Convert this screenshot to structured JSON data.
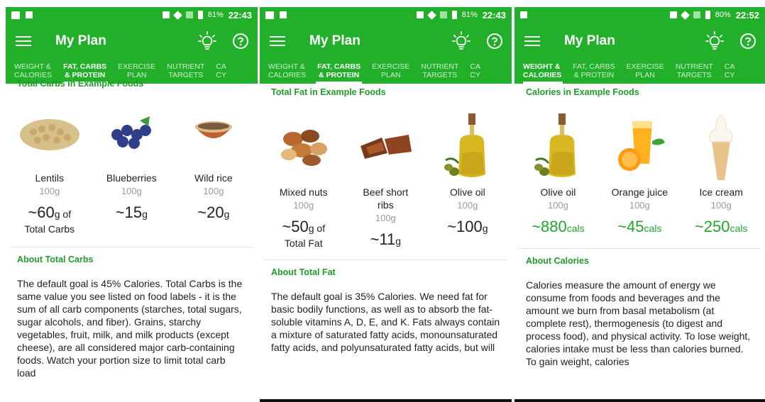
{
  "status": {
    "battery": [
      "81%",
      "81%",
      "80%"
    ],
    "time": [
      "22:43",
      "22:43",
      "22:52"
    ]
  },
  "appbar": {
    "title": "My Plan"
  },
  "tabs": {
    "weight": [
      "WEIGHT &",
      "CALORIES"
    ],
    "fat": [
      "FAT, CARBS",
      "& PROTEIN"
    ],
    "exercise": [
      "EXERCISE",
      "PLAN"
    ],
    "nutrient": [
      "NUTRIENT",
      "TARGETS"
    ],
    "cycle_partial": [
      "CA",
      "CY"
    ]
  },
  "screens": [
    {
      "active_tab": "fat",
      "section": "Total Carbs in Example Foods",
      "foods": [
        {
          "name": "Lentils",
          "portion": "100g",
          "amount": "~60",
          "unit": "g",
          "suffix": " of",
          "note": "Total Carbs"
        },
        {
          "name": "Blueberries",
          "portion": "100g",
          "amount": "~15",
          "unit": "g"
        },
        {
          "name": "Wild rice",
          "portion": "100g",
          "amount": "~20",
          "unit": "g"
        }
      ],
      "about_title": "About Total Carbs",
      "about_text": "The default goal is 45% Calories. Total Carbs is the same value you see listed on food labels - it is the sum of all carb components (starches, total sugars, sugar alcohols, and fiber). Grains, starchy vegetables, fruit, milk, and milk products (except cheese), are all considered major carb-containing foods. Watch your portion size to limit total carb load"
    },
    {
      "active_tab": "fat",
      "section": "Total Fat in Example Foods",
      "foods": [
        {
          "name": "Mixed nuts",
          "portion": "100g",
          "amount": "~50",
          "unit": "g",
          "suffix": " of",
          "note": "Total Fat"
        },
        {
          "name": "Beef short ribs",
          "portion": "100g",
          "amount": "~11",
          "unit": "g"
        },
        {
          "name": "Olive oil",
          "portion": "100g",
          "amount": "~100",
          "unit": "g"
        }
      ],
      "about_title": "About Total Fat",
      "about_text": "The default goal is 35% Calories. We need fat for basic bodily functions, as well as to absorb the fat-soluble vitamins A, D, E, and K. Fats always contain a mixture of saturated fatty acids, monounsaturated fatty acids, and polyunsaturated fatty acids, but will"
    },
    {
      "active_tab": "weight",
      "section": "Calories in Example Foods",
      "foods": [
        {
          "name": "Olive oil",
          "portion": "100g",
          "amount": "~880",
          "unit": "cals"
        },
        {
          "name": "Orange juice",
          "portion": "100g",
          "amount": "~45",
          "unit": "cals"
        },
        {
          "name": "Ice cream",
          "portion": "100g",
          "amount": "~250",
          "unit": "cals"
        }
      ],
      "about_title": "About Calories",
      "about_text": "Calories measure the amount of energy we consume from foods and beverages and the amount we burn from basal metabolism (at complete rest), thermogenesis (to digest and process food), and physical activity. To lose weight, calories intake must be less than calories burned. To gain weight, calories"
    }
  ],
  "colors": {
    "brand": "#22b02a",
    "accent_text": "#1f9c2a"
  },
  "icons": [
    "menu-icon",
    "lightbulb-icon",
    "help-icon"
  ]
}
